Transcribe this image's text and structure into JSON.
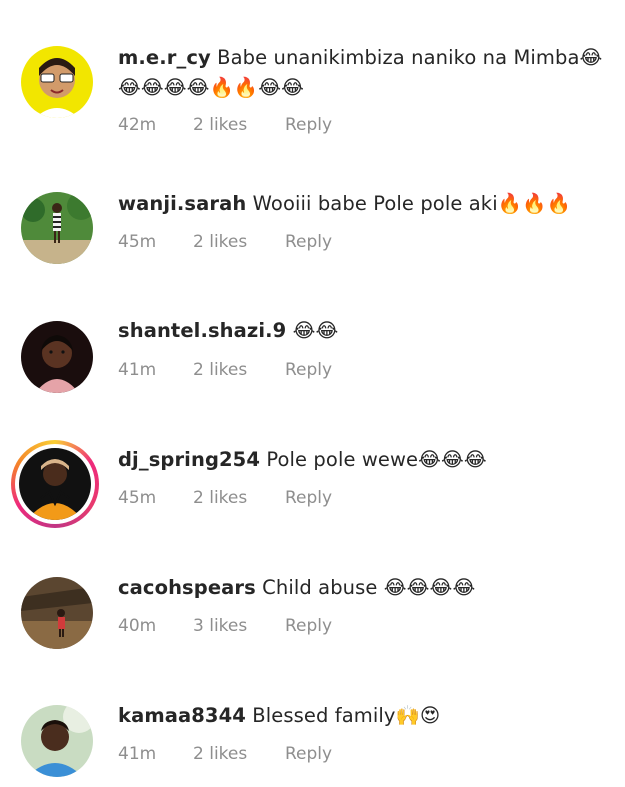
{
  "comments": [
    {
      "username": "m.e.r_cy",
      "text": "Babe unanikimbiza naniko na Mimba😂😂😂😂😂🔥🔥😂😂",
      "time": "42m",
      "likes": "2 likes",
      "reply": "Reply",
      "has_story": false
    },
    {
      "username": "wanji.sarah",
      "text": "Wooiii babe Pole pole aki🔥🔥🔥",
      "time": "45m",
      "likes": "2 likes",
      "reply": "Reply",
      "has_story": false
    },
    {
      "username": "shantel.shazi.9",
      "text": "😂😂",
      "time": "41m",
      "likes": "2 likes",
      "reply": "Reply",
      "has_story": false
    },
    {
      "username": "dj_spring254",
      "text": "Pole pole wewe😂😂😂",
      "time": "45m",
      "likes": "2 likes",
      "reply": "Reply",
      "has_story": true
    },
    {
      "username": "cacohspears",
      "text": "Child abuse 😂😂😂😂",
      "time": "40m",
      "likes": "3 likes",
      "reply": "Reply",
      "has_story": false
    },
    {
      "username": "kamaa8344",
      "text": "Blessed family🙌😍",
      "time": "41m",
      "likes": "2 likes",
      "reply": "Reply",
      "has_story": false
    }
  ]
}
